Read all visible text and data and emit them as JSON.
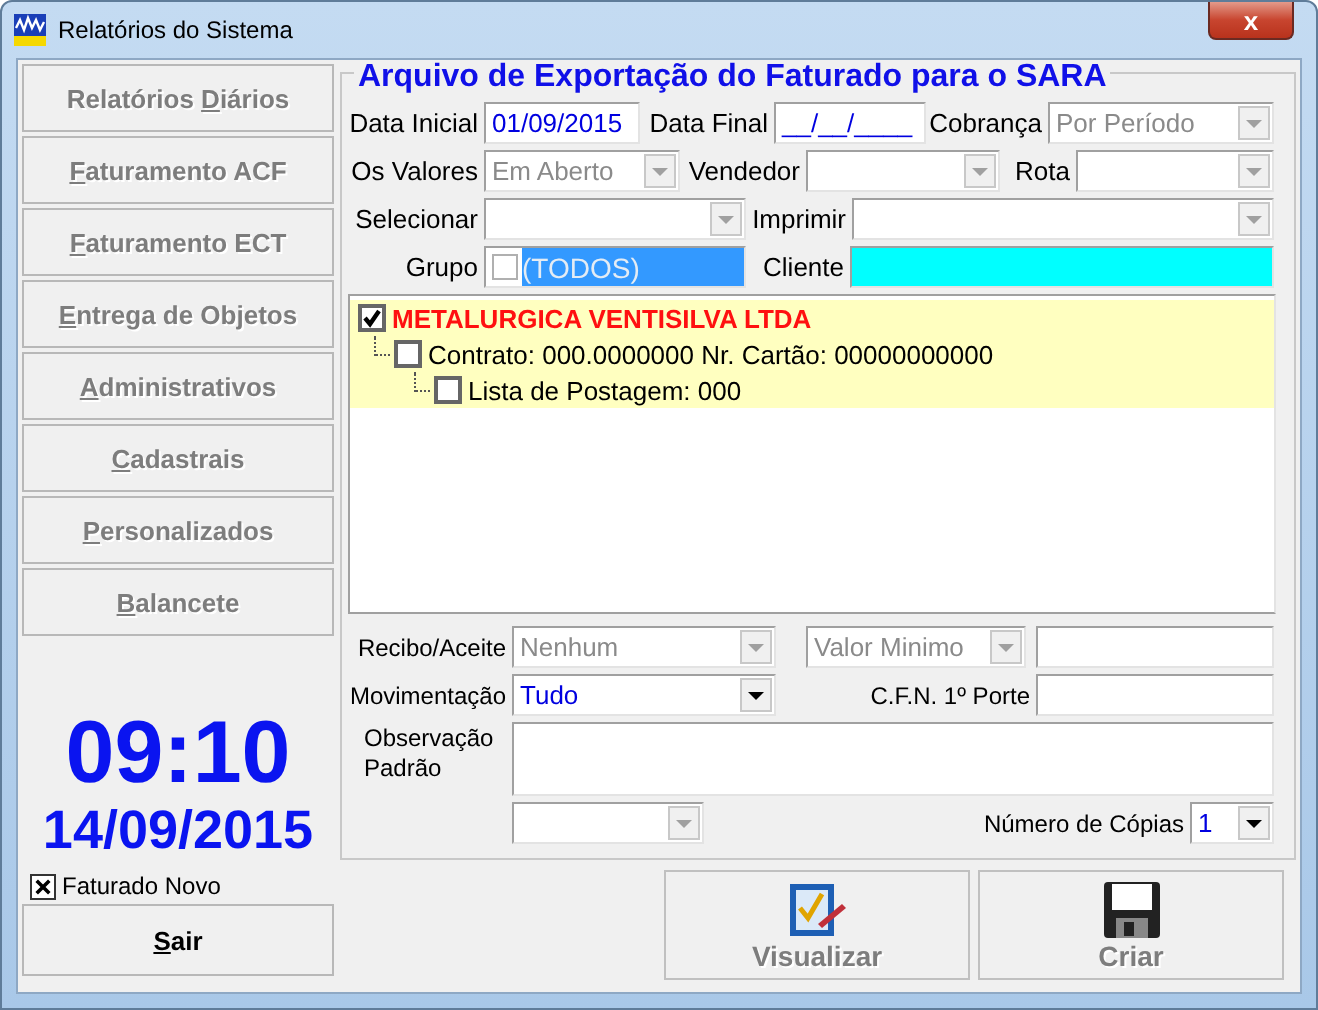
{
  "window": {
    "title": "Relatórios do Sistema",
    "close": "x"
  },
  "sidebar": {
    "buttons": [
      {
        "before": "Relatórios ",
        "accesskey": "D",
        "after": "iários",
        "disabled": true
      },
      {
        "accesskey": "F",
        "after": "aturamento ACF",
        "disabled": true
      },
      {
        "accesskey": "F",
        "after": "aturamento ECT",
        "disabled": true
      },
      {
        "accesskey": "E",
        "after": "ntrega de Objetos",
        "disabled": true
      },
      {
        "accesskey": "A",
        "after": "dministrativos",
        "disabled": true
      },
      {
        "accesskey": "C",
        "after": "adastrais",
        "disabled": true
      },
      {
        "accesskey": "P",
        "after": "ersonalizados",
        "disabled": true
      },
      {
        "accesskey": "B",
        "after": "alancete",
        "disabled": true
      }
    ]
  },
  "clock": {
    "time": "09:10",
    "date": "14/09/2015"
  },
  "faturado_novo": {
    "label": "Faturado Novo",
    "checked": true
  },
  "exit_button": {
    "accesskey": "S",
    "after": "air",
    "disabled": false
  },
  "panel": {
    "title": "Arquivo de Exportação do Faturado para o SARA"
  },
  "filter_rows": [
    {
      "items": [
        {
          "kind": "label",
          "text": "Data Inicial"
        },
        {
          "kind": "edit",
          "value": "01/09/2015"
        },
        {
          "kind": "label",
          "text": "Data Final"
        },
        {
          "kind": "edit",
          "value": "__/__/____"
        },
        {
          "kind": "label",
          "text": "Cobrança"
        },
        {
          "kind": "combo",
          "value": "Por Período",
          "disabled": true
        }
      ]
    },
    {
      "items": [
        {
          "kind": "label",
          "text": "Os Valores"
        },
        {
          "kind": "combo",
          "value": "Em Aberto",
          "disabled": true
        },
        {
          "kind": "label",
          "text": "Vendedor"
        },
        {
          "kind": "combo",
          "disabled": true
        },
        {
          "kind": "label",
          "text": "Rota"
        },
        {
          "kind": "combo",
          "disabled": true
        }
      ]
    },
    {
      "items": [
        {
          "kind": "label",
          "text": "Selecionar"
        },
        {
          "kind": "combo",
          "disabled": true
        },
        {
          "kind": "label",
          "text": "Imprimir"
        },
        {
          "kind": "combo",
          "disabled": true
        }
      ]
    },
    {
      "items": [
        {
          "kind": "label",
          "text": "Grupo"
        },
        {
          "kind": "group",
          "value": "(TODOS)",
          "checked": false
        },
        {
          "kind": "label",
          "text": "Cliente"
        },
        {
          "kind": "client"
        }
      ]
    }
  ],
  "tree": [
    {
      "text": "METALURGICA VENTISILVA LTDA",
      "checked": true,
      "children": [
        {
          "text": "Contrato:  000.0000000 Nr. Cartão: 00000000000",
          "checked": false,
          "children": [
            {
              "text": "Lista de Postagem: 000",
              "checked": false
            }
          ]
        }
      ]
    }
  ],
  "option_rows": [
    {
      "items": [
        {
          "kind": "label",
          "text": "Recibo/Aceite"
        },
        {
          "kind": "combo",
          "value": "Nenhum",
          "disabled": true
        },
        {
          "kind": "combo",
          "value": "Valor Minimo",
          "disabled": true
        },
        {
          "kind": "edit"
        }
      ]
    },
    {
      "items": [
        {
          "kind": "label",
          "text": "Movimentação"
        },
        {
          "kind": "combo",
          "value": "Tudo",
          "disabled": false
        },
        {
          "kind": "label",
          "text": "C.F.N. 1º Porte"
        },
        {
          "kind": "edit"
        }
      ]
    },
    {
      "items": [
        {
          "kind": "label",
          "text": "Observação Padrão"
        },
        {
          "kind": "memo"
        }
      ]
    },
    {
      "items": [
        {
          "kind": "spacer"
        },
        {
          "kind": "combo",
          "disabled": true
        },
        {
          "kind": "label",
          "text": "Número de Cópias"
        },
        {
          "kind": "combo",
          "value": "1",
          "disabled": false
        }
      ]
    }
  ],
  "actions": [
    {
      "label": "Visualizar",
      "kind": "preview",
      "disabled": true
    },
    {
      "label": "Criar",
      "kind": "save",
      "disabled": true
    }
  ]
}
